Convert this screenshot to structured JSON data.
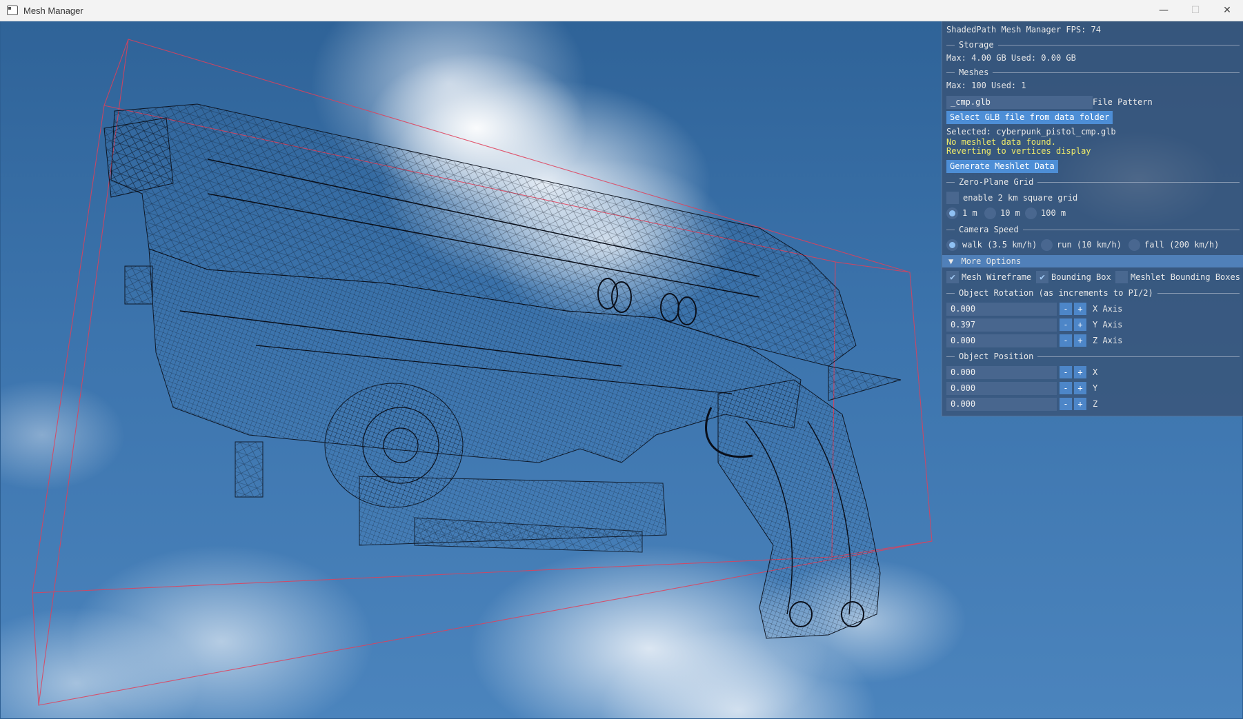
{
  "window": {
    "title": "Mesh Manager",
    "minimize_glyph": "—",
    "maximize_glyph": "☐",
    "close_glyph": "✕"
  },
  "panel": {
    "header": "ShadedPath Mesh Manager FPS: 74",
    "storage": {
      "section": "Storage",
      "info": "Max: 4.00 GB Used: 0.00 GB"
    },
    "meshes": {
      "section": "Meshes",
      "info": "Max: 100 Used: 1",
      "file_pattern_value": "_cmp.glb",
      "file_pattern_label": "File Pattern",
      "select_button": "Select GLB file from data folder",
      "selected": "Selected: cyberpunk_pistol_cmp.glb",
      "warning_line1": "No meshlet data found.",
      "warning_line2": "Reverting to vertices display",
      "generate_button": "Generate Meshlet Data"
    },
    "grid": {
      "section": "Zero-Plane Grid",
      "enable_label": "enable 2 km square grid",
      "enable_checked": false,
      "options": [
        "1 m",
        "10 m",
        "100 m"
      ],
      "selected": "1 m"
    },
    "camera": {
      "section": "Camera Speed",
      "options": [
        "walk (3.5 km/h)",
        "run (10 km/h)",
        "fall (200 km/h)"
      ],
      "selected": "walk (3.5 km/h)"
    },
    "more_options": {
      "header": "More Options",
      "arrow": "▼",
      "checkboxes": [
        {
          "label": "Mesh Wireframe",
          "checked": true
        },
        {
          "label": "Bounding Box",
          "checked": true
        },
        {
          "label": "Meshlet Bounding Boxes",
          "checked": false
        }
      ]
    },
    "rotation": {
      "section": "Object Rotation (as increments to PI/2)",
      "rows": [
        {
          "value": "0.000",
          "label": "X Axis"
        },
        {
          "value": "0.397",
          "label": "Y Axis"
        },
        {
          "value": "0.000",
          "label": "Z Axis"
        }
      ]
    },
    "position": {
      "section": "Object Position",
      "rows": [
        {
          "value": "0.000",
          "label": "X"
        },
        {
          "value": "0.000",
          "label": "Y"
        },
        {
          "value": "0.000",
          "label": "Z"
        }
      ]
    },
    "minus": "-",
    "plus": "+",
    "check_glyph": "✔"
  },
  "colors": {
    "accent": "#4d8ed6",
    "warning": "#f0ec6a",
    "bounding_box": "#e0405a",
    "wireframe": "#0a0f1a"
  }
}
